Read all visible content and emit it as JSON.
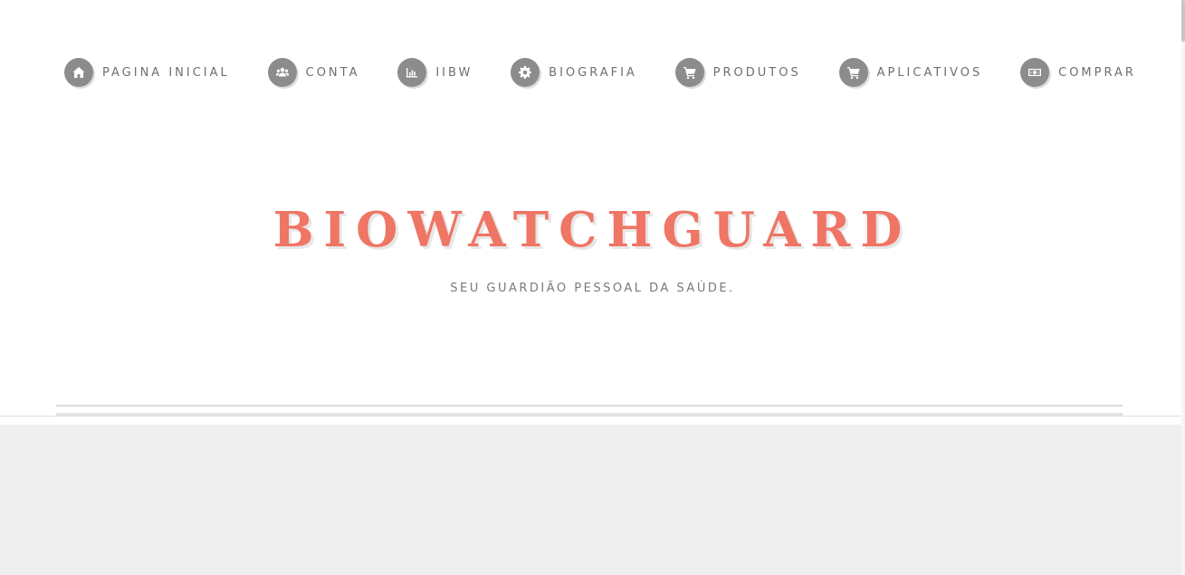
{
  "nav": {
    "items": [
      {
        "label": "PAGINA INICIAL",
        "icon": "home-icon"
      },
      {
        "label": "CONTA",
        "icon": "users-icon"
      },
      {
        "label": "IIBW",
        "icon": "bar-chart-icon"
      },
      {
        "label": "BIOGRAFIA",
        "icon": "gear-icon"
      },
      {
        "label": "PRODUTOS",
        "icon": "cart-icon"
      },
      {
        "label": "APLICATIVOS",
        "icon": "cart-icon"
      },
      {
        "label": "COMPRAR",
        "icon": "money-icon"
      }
    ]
  },
  "hero": {
    "title": "BIOWATCHGUARD",
    "subtitle": "SEU GUARDIÃO PESSOAL DA SAÚDE."
  },
  "colors": {
    "accent": "#ef7565",
    "icon_bg": "#8c8c8c",
    "nav_text": "#6f6f6f",
    "content_bg": "#efefef"
  }
}
